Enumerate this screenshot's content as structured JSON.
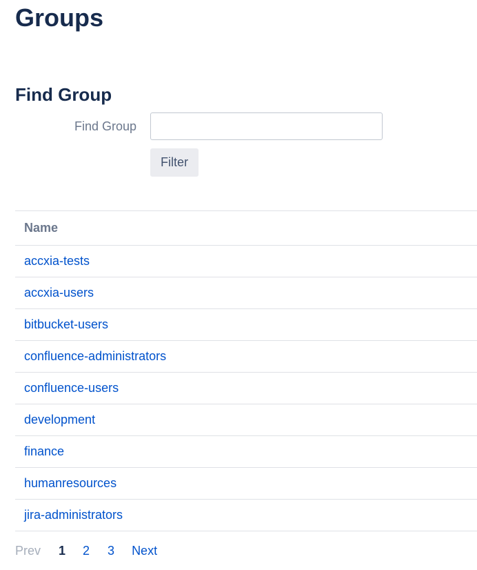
{
  "page": {
    "title": "Groups"
  },
  "find_group": {
    "section_title": "Find Group",
    "label": "Find Group",
    "input_value": "",
    "filter_label": "Filter"
  },
  "table": {
    "header_name": "Name",
    "rows": [
      "accxia-tests",
      "accxia-users",
      "bitbucket-users",
      "confluence-administrators",
      "confluence-users",
      "development",
      "finance",
      "humanresources",
      "jira-administrators"
    ]
  },
  "pagination": {
    "prev": "Prev",
    "current": "1",
    "page_2": "2",
    "page_3": "3",
    "next": "Next"
  },
  "colors": {
    "link": "#0052cc",
    "heading": "#172b4d",
    "muted": "#6b778c",
    "border": "#dfe1e6"
  }
}
